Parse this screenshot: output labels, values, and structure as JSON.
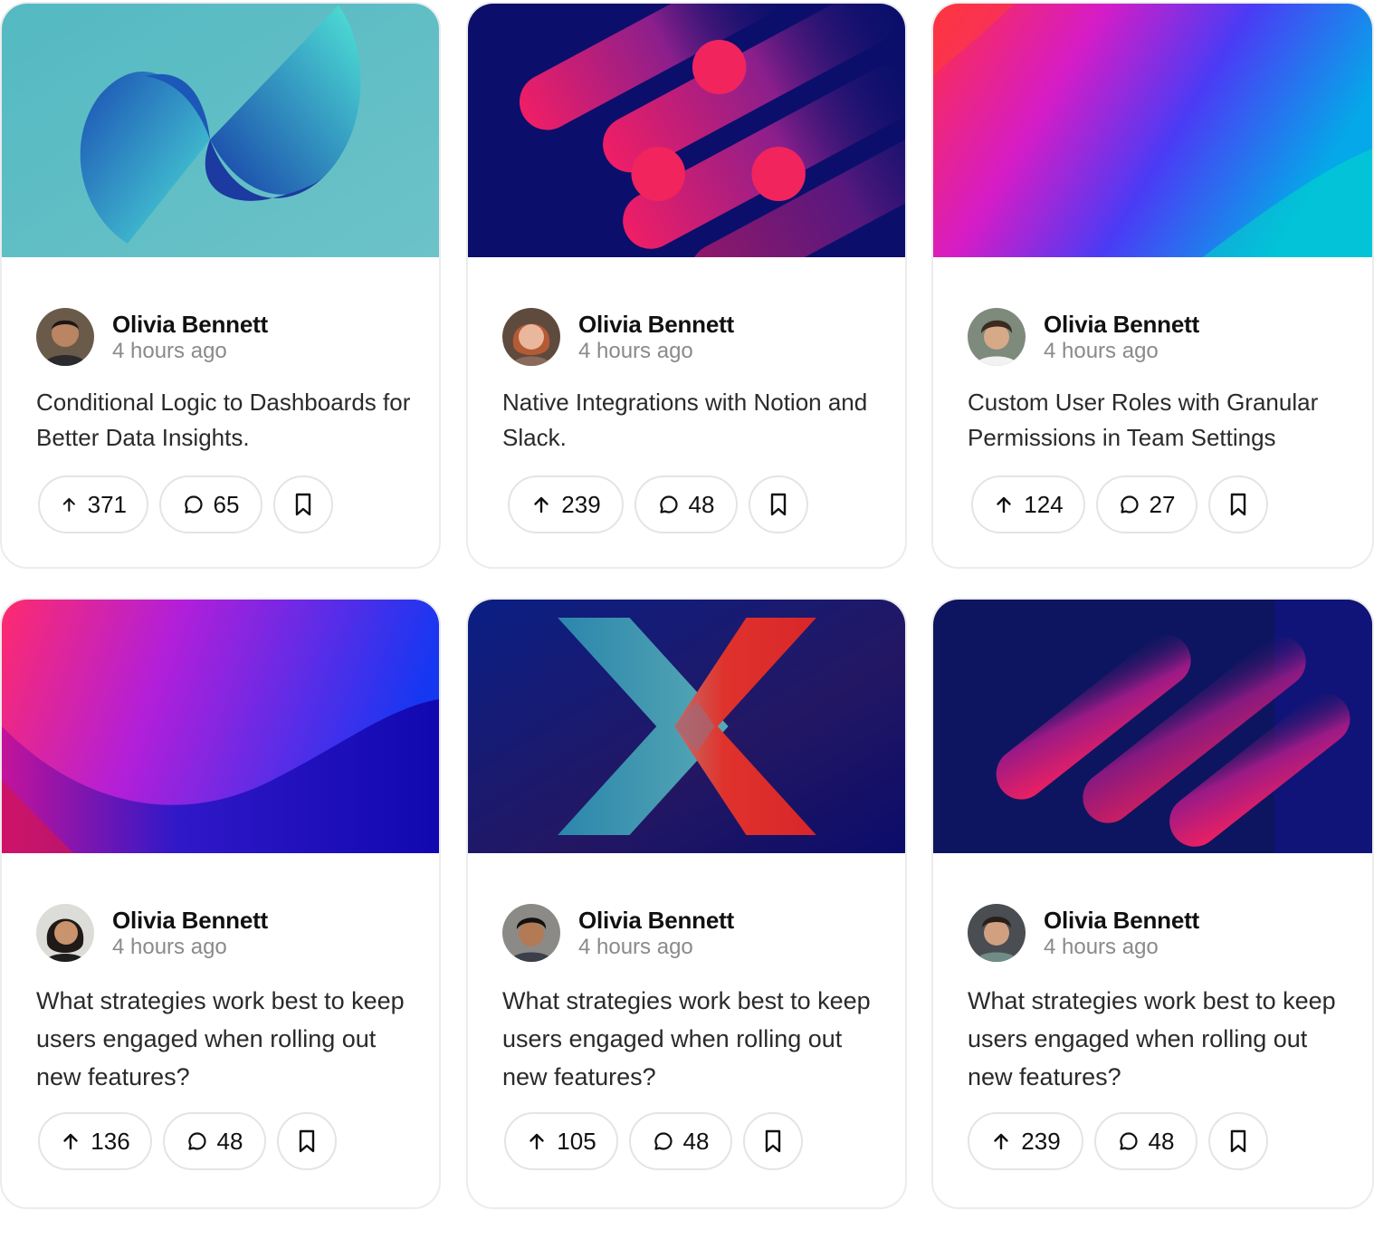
{
  "cards": [
    {
      "author": "Olivia Bennett",
      "time": "4 hours ago",
      "title": "Conditional Logic to Dashboards for Better Data Insights.",
      "upvotes": "371",
      "comments": "65",
      "cover": "teal-spheres-art",
      "avatar": "young-man-smiling"
    },
    {
      "author": "Olivia Bennett",
      "time": "4 hours ago",
      "title": "Native Integrations with Notion and Slack.",
      "upvotes": "239",
      "comments": "48",
      "cover": "navy-pink-capsules-art",
      "avatar": "red-haired-woman"
    },
    {
      "author": "Olivia Bennett",
      "time": "4 hours ago",
      "title": "Custom User Roles with Granular Permissions in Team Settings",
      "upvotes": "124",
      "comments": "27",
      "cover": "red-magenta-blue-gradient",
      "avatar": "young-man-tousled-hair"
    },
    {
      "author": "Olivia Bennett",
      "time": "4 hours ago",
      "title": "What strategies work best to keep users engaged when rolling out new features?",
      "upvotes": "136",
      "comments": "48",
      "cover": "pink-violet-wave-gradient",
      "avatar": "dark-haired-woman"
    },
    {
      "author": "Olivia Bennett",
      "time": "4 hours ago",
      "title": "What strategies work best to keep users engaged when rolling out new features?",
      "upvotes": "105",
      "comments": "48",
      "cover": "teal-red-x-art",
      "avatar": "man-dark-hair"
    },
    {
      "author": "Olivia Bennett",
      "time": "4 hours ago",
      "title": "What strategies work best to keep users engaged when rolling out new features?",
      "upvotes": "239",
      "comments": "48",
      "cover": "navy-pink-stripes-art",
      "avatar": "smiling-man-beard"
    }
  ],
  "icons": {
    "upvote": "arrow-up-icon",
    "comment": "comment-bubble-icon",
    "bookmark": "bookmark-icon"
  },
  "colors": {
    "border": "#ececec",
    "muted_text": "#8a8a8a",
    "pill_border": "#e4e4e4"
  }
}
